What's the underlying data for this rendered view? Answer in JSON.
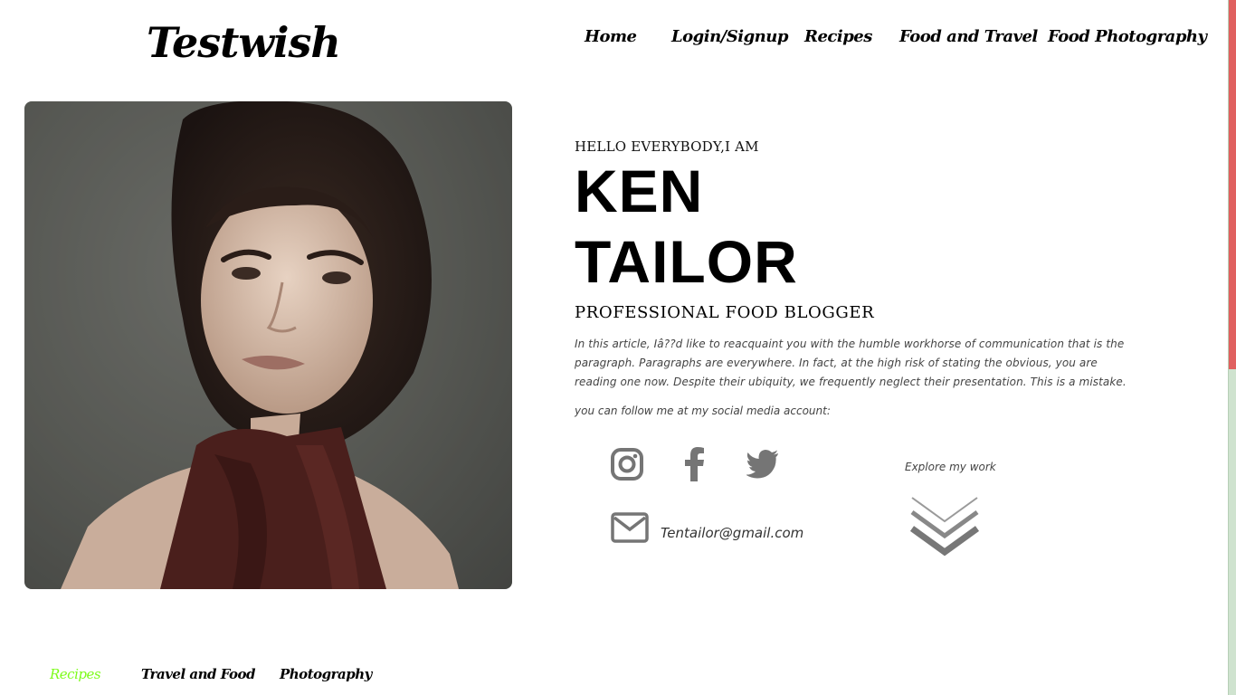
{
  "site": {
    "logo": "Testwish"
  },
  "nav": {
    "items": [
      "Home",
      "Login/Signup",
      "Recipes",
      "Food and Travel",
      "Food Photography"
    ]
  },
  "hero": {
    "greeting": "HELLO EVERYBODY,I AM",
    "first_name": "KEN",
    "last_name": "TAILOR",
    "role": "PROFESSIONAL FOOD BLOGGER",
    "paragraph": "In this article, Iâ??d like to reacquaint you with the humble workhorse of communication that is the paragraph. Paragraphs are everywhere. In fact, at the high risk of stating the obvious, you are reading one now. Despite their ubiquity, we frequently neglect their presentation. This is a mistake.",
    "follow_text": "you can follow me at my social media account:",
    "email": "Tentailor@gmail.com",
    "explore": "Explore my work"
  },
  "social": {
    "icons": [
      "instagram-icon",
      "facebook-icon",
      "twitter-icon",
      "mail-icon"
    ],
    "icon_color": "#757575"
  },
  "tabs": {
    "items": [
      "Recipes",
      "Travel and Food",
      "Photography"
    ],
    "active": "Recipes",
    "active_color": "#7dfc1a"
  },
  "colors": {
    "scroll_thumb": "#e0605f",
    "scroll_track": "#cfe3cf"
  }
}
